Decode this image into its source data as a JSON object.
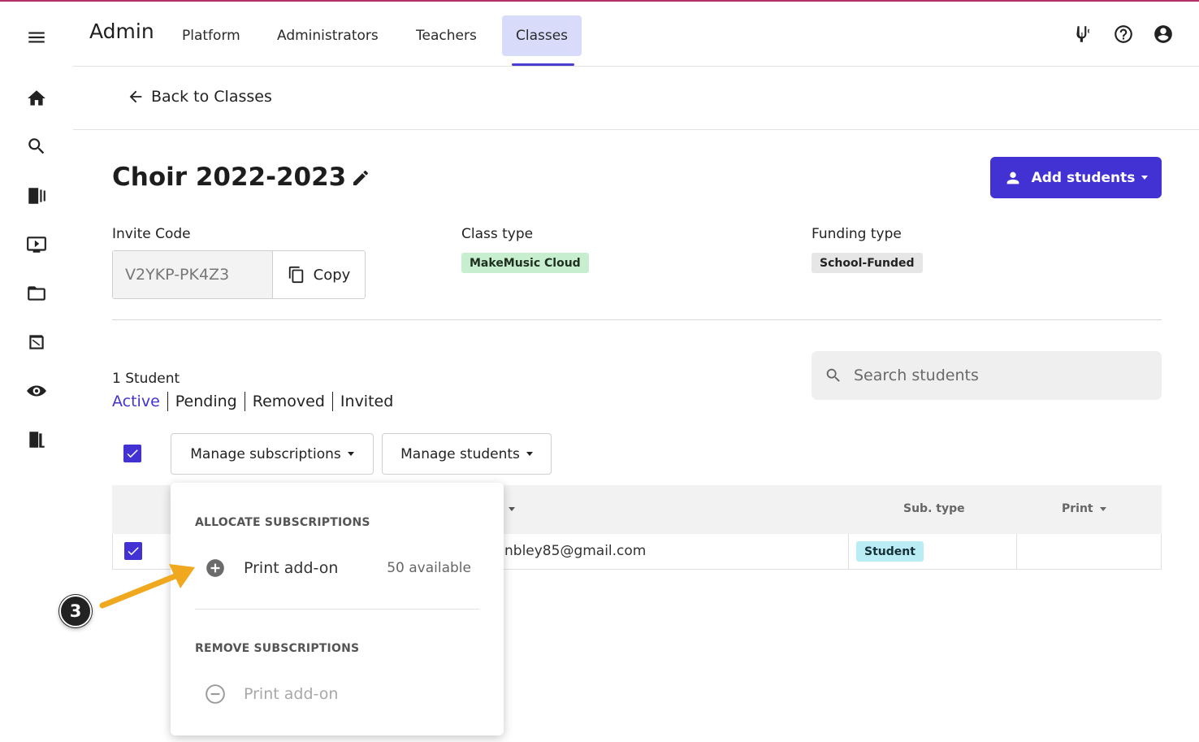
{
  "header": {
    "brand": "Admin",
    "nav": [
      "Platform",
      "Administrators",
      "Teachers",
      "Classes"
    ],
    "active_nav": "Classes",
    "icons": [
      "tuner-icon",
      "help-icon",
      "account-icon"
    ]
  },
  "rail": {
    "icons": [
      "menu-icon",
      "home-icon",
      "search-icon",
      "library-icon",
      "video-icon",
      "folder-icon",
      "assignments-icon",
      "listen-icon",
      "exit-icon"
    ]
  },
  "back": {
    "label": "Back to Classes"
  },
  "class": {
    "title": "Choir 2022-2023",
    "add_students": "Add students",
    "invite_label": "Invite Code",
    "invite_code": "V2YKP-PK4Z3",
    "copy_label": "Copy",
    "class_type_label": "Class type",
    "class_type": "MakeMusic Cloud",
    "funding_label": "Funding type",
    "funding": "School-Funded"
  },
  "students": {
    "count": "1 Student",
    "filters": [
      "Active",
      "Pending",
      "Removed",
      "Invited"
    ],
    "active_filter": "Active",
    "search_placeholder": "Search students",
    "manage_subscriptions": "Manage subscriptions",
    "manage_students": "Manage students",
    "columns": {
      "sub_type": "Sub. type",
      "print": "Print"
    },
    "rows": [
      {
        "email": "nbley85@gmail.com",
        "sub_type": "Student",
        "print": ""
      }
    ]
  },
  "menu": {
    "allocate_header": "ALLOCATE SUBSCRIPTIONS",
    "allocate_item": "Print add-on",
    "allocate_available": "50 available",
    "remove_header": "REMOVE SUBSCRIPTIONS",
    "remove_item": "Print add-on"
  },
  "annotation": {
    "step": "3"
  },
  "colors": {
    "accent": "#4332d3",
    "arrow": "#f0a81e",
    "green_chip": "#c7efcf",
    "student_chip": "#b9ecf4"
  }
}
